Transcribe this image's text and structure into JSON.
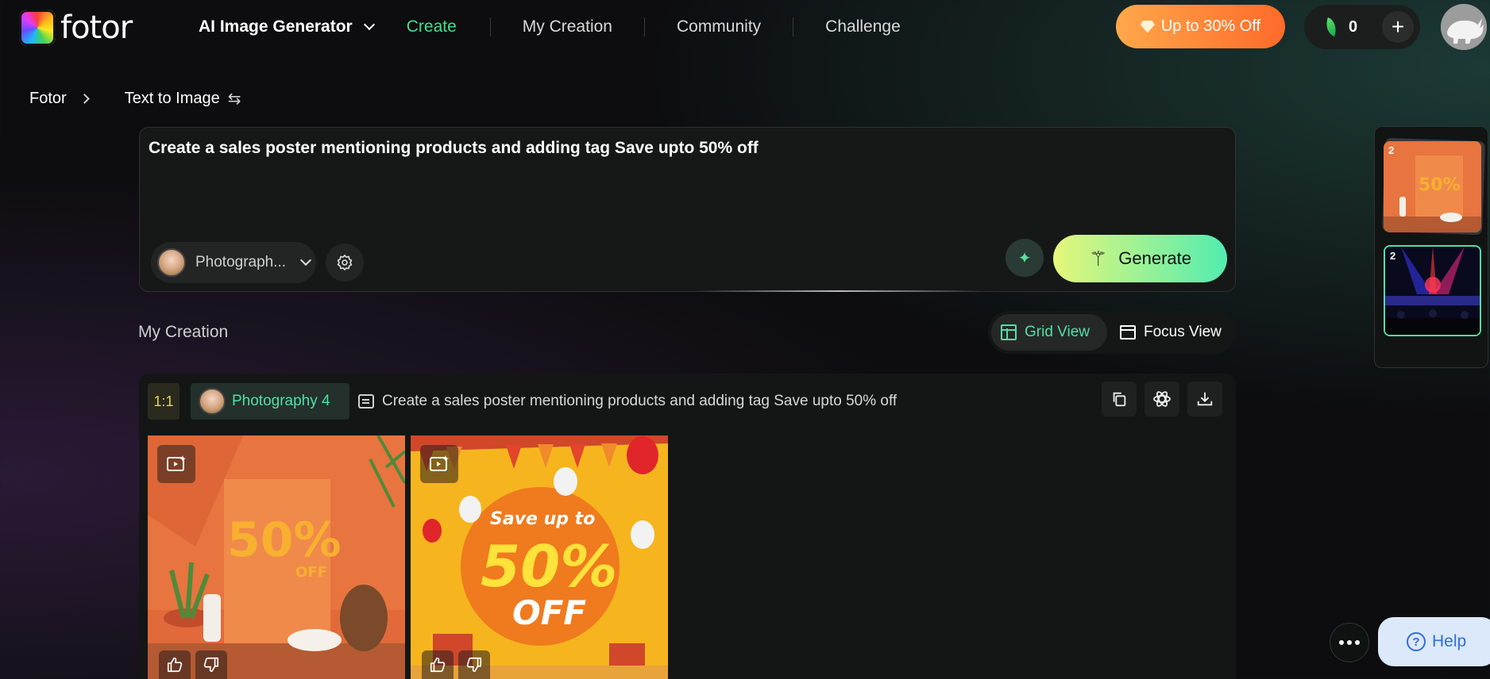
{
  "header": {
    "logo_text": "fotor",
    "nav": {
      "dropdown_label": "AI Image Generator",
      "create": "Create",
      "my_creation": "My Creation",
      "community": "Community",
      "challenge": "Challenge"
    },
    "promo_label": "Up to 30% Off",
    "credits": "0",
    "plus": "+"
  },
  "breadcrumb": {
    "root": "Fotor",
    "current": "Text to Image"
  },
  "prompt": {
    "text": "Create a sales poster mentioning products and adding tag Save upto 50% off",
    "style_label": "Photograph...",
    "generate_label": "Generate"
  },
  "section": {
    "title": "My Creation",
    "grid_view": "Grid View",
    "focus_view": "Focus View"
  },
  "creation": {
    "ratio": "1:1",
    "model": "Photography 4",
    "prompt": "Create a sales poster mentioning products and adding tag Save upto 50% off",
    "images": [
      {
        "text_big": "50%",
        "text_small": "OFF"
      },
      {
        "text_top": "Save up to",
        "text_big": "50%",
        "text_small": "OFF"
      }
    ]
  },
  "history": [
    {
      "count": "2",
      "text": "50%"
    },
    {
      "count": "2"
    }
  ],
  "floating": {
    "help_label": "Help"
  },
  "colors": {
    "accent_green": "#4fe0a5",
    "create_green": "#3ee08a",
    "promo_orange": "#ff6a2a",
    "help_blue": "#2f6ee0"
  }
}
